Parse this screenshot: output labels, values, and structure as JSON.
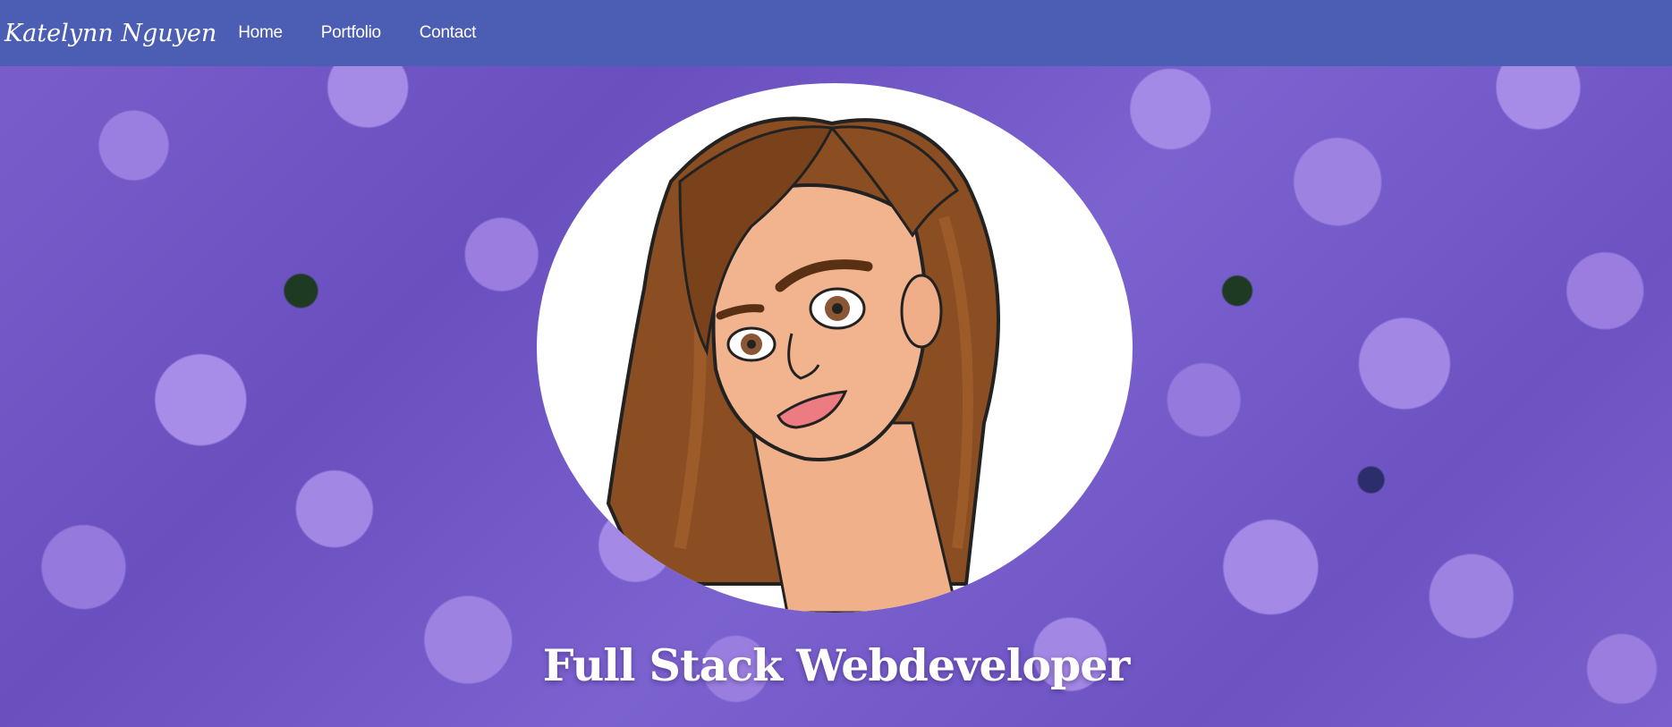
{
  "navbar": {
    "brand": "Katelynn Nguyen",
    "links": [
      {
        "label": "Home"
      },
      {
        "label": "Portfolio"
      },
      {
        "label": "Contact"
      }
    ],
    "background_color": "#4c5eb4"
  },
  "hero": {
    "background": "purple bellflower field",
    "avatar": "cartoon-portrait-illustration",
    "headline": "Full Stack Webdeveloper"
  },
  "colors": {
    "navbar": "#4c5eb4",
    "text": "#ffffff",
    "flower_purple": "#9b7fe0"
  }
}
